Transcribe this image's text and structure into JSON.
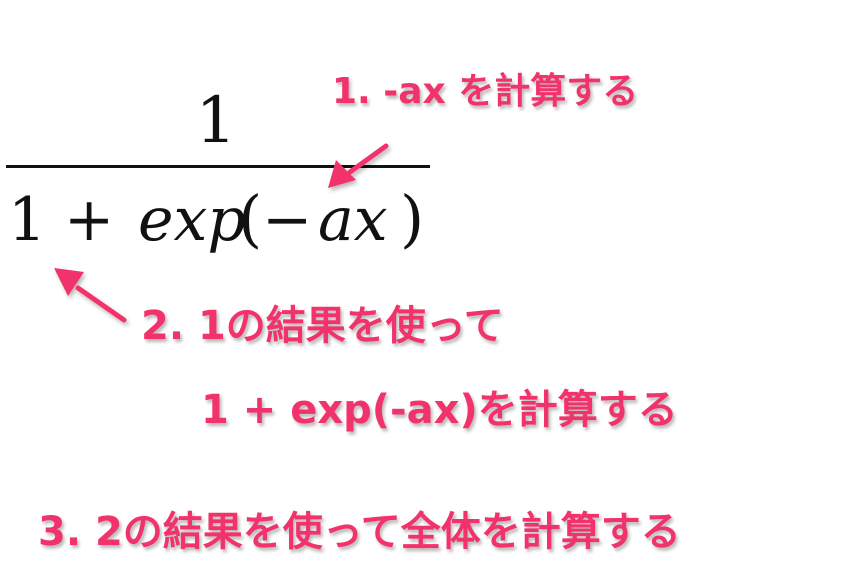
{
  "formula": {
    "numerator": "1",
    "denominator_one": "1",
    "plus_sign": "+",
    "exp_text": "exp",
    "open_paren": "(",
    "minus_sign": "−",
    "ax_text": "ax",
    "close_paren": ")"
  },
  "annotations": {
    "step1": "1. -ax を計算する",
    "step2_line1": "2. 1の結果を使って",
    "step2_line2": "1 + exp(-ax)を計算する",
    "step3": "3. 2の結果を使って全体を計算する"
  },
  "colors": {
    "annotation": "#f2336b",
    "formula": "#111111"
  }
}
